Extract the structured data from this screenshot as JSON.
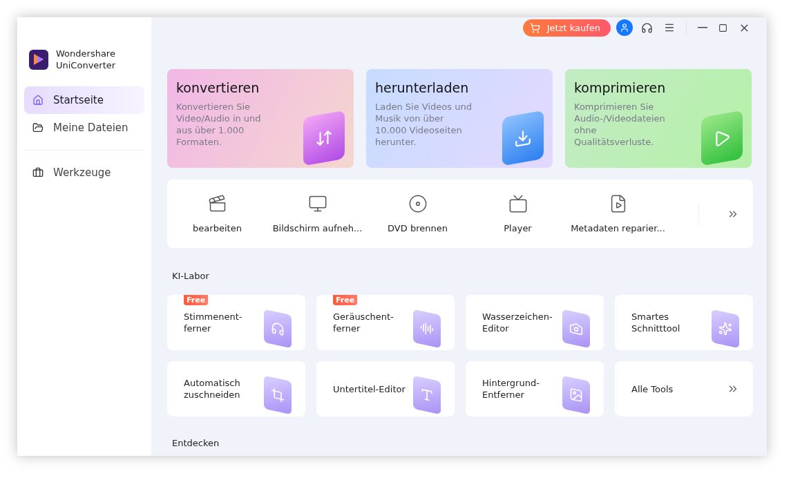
{
  "app": {
    "name_line1": "Wondershare",
    "name_line2": "UniConverter"
  },
  "sidebar": {
    "items": [
      {
        "label": "Startseite",
        "kind": "home",
        "selected": true
      },
      {
        "label": "Meine Dateien",
        "kind": "folder",
        "selected": false
      }
    ],
    "items_after_divider": [
      {
        "label": "Werkzeuge",
        "kind": "toolbox",
        "selected": false
      }
    ]
  },
  "topbar": {
    "buy_button": "Jetzt kaufen"
  },
  "feature_cards": [
    {
      "kind": "convert",
      "title": "konvertieren",
      "description": "Konvertieren Sie Video/Audio in und aus über 1.000 Formaten."
    },
    {
      "kind": "download",
      "title": "herunterladen",
      "description": "Laden Sie Videos und Musik von über 10.000 Videoseiten herunter."
    },
    {
      "kind": "compress",
      "title": "komprimieren",
      "description": "Komprimieren Sie Audio-/Videodateien ohne Qualitätsverluste."
    }
  ],
  "tools": [
    {
      "kind": "edit",
      "label": "bearbeiten"
    },
    {
      "kind": "screen",
      "label": "Bildschirm aufneh..."
    },
    {
      "kind": "dvd",
      "label": "DVD brennen"
    },
    {
      "kind": "player",
      "label": "Player"
    },
    {
      "kind": "metadata",
      "label": "Metadaten reparier..."
    }
  ],
  "ai_lab": {
    "heading": "KI-Labor",
    "tools": [
      {
        "kind": "voice",
        "label": "Stimmenent-\nferner",
        "badge": "Free"
      },
      {
        "kind": "noise",
        "label": "Geräuschent-\nferner",
        "badge": "Free"
      },
      {
        "kind": "watermark",
        "label": "Wasserzeichen-\nEditor"
      },
      {
        "kind": "smartcut",
        "label": "Smartes\nSchnitttool"
      },
      {
        "kind": "crop",
        "label": "Automatisch\nzuschneiden"
      },
      {
        "kind": "subtitle",
        "label": "Untertitel-Editor"
      },
      {
        "kind": "background",
        "label": "Hintergrund-\nEntferner"
      },
      {
        "kind": "more",
        "label": "Alle Tools"
      }
    ]
  },
  "discover": {
    "heading": "Entdecken"
  }
}
